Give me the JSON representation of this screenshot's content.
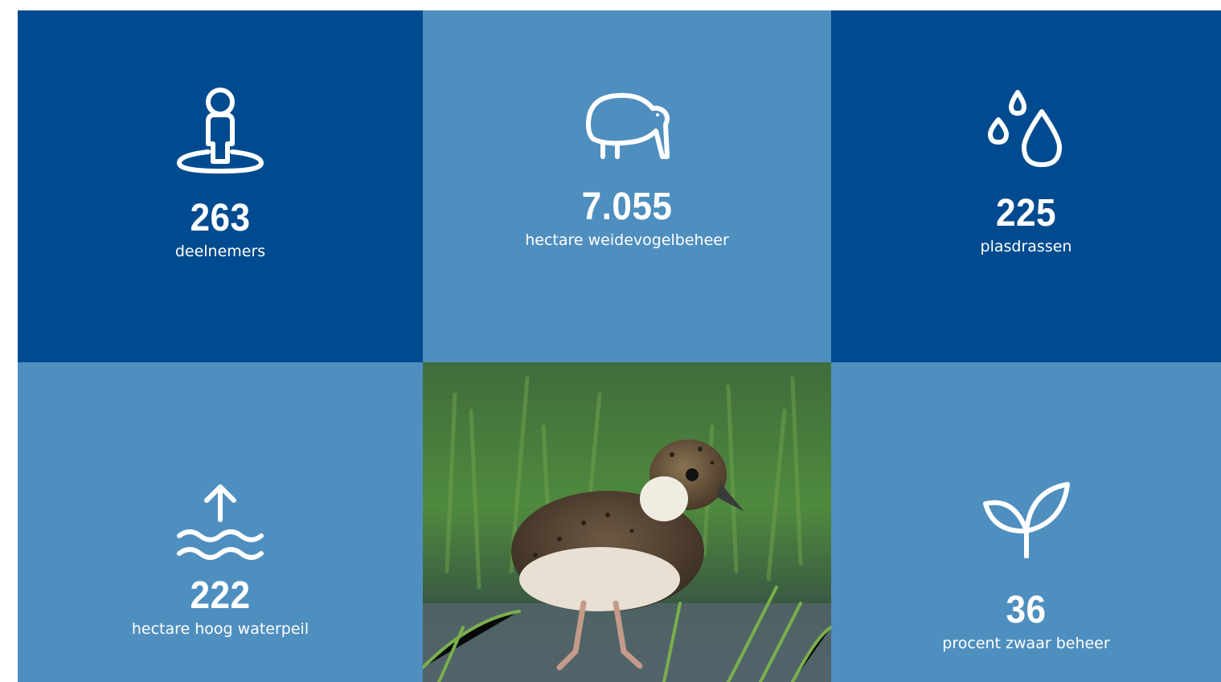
{
  "stats": [
    {
      "value": "263",
      "label": "deelnemers",
      "icon": "person-location-icon"
    },
    {
      "value": "7.055",
      "label": "hectare weidevogelbeheer",
      "icon": "kiwi-bird-icon"
    },
    {
      "value": "225",
      "label": "plasdrassen",
      "icon": "water-drops-icon"
    },
    {
      "value": "222",
      "label": "hectare hoog waterpeil",
      "icon": "water-level-up-icon"
    },
    {
      "value": "36",
      "label": "procent zwaar beheer",
      "icon": "sprout-icon"
    }
  ],
  "photo": {
    "subject": "lapwing-chick-photo"
  },
  "colors": {
    "dark_tile": "#004b8f",
    "light_tile": "#4f8fbf",
    "text": "#ffffff"
  }
}
